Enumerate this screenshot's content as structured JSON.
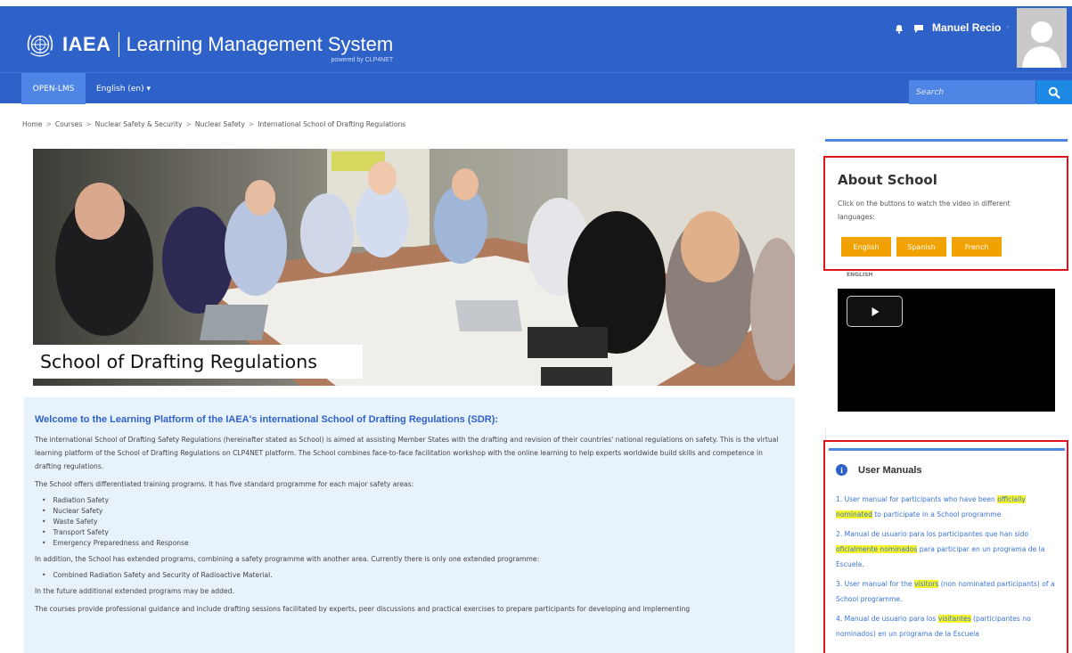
{
  "header": {
    "logo_text": "IAEA",
    "product_title": "Learning Management System",
    "powered_by": "powered by CLP4NET",
    "user_name": "Manuel Recio",
    "user_caret": "-"
  },
  "nav": {
    "home_item": "OPEN-LMS",
    "language": "English (en) ▾",
    "search_placeholder": "Search"
  },
  "breadcrumb": [
    "Home",
    "Courses",
    "Nuclear Safety & Security",
    "Nuclear Safety",
    "International School of Drafting Regulations"
  ],
  "breadcrumb_sep": ">",
  "hero": {
    "caption": "School of Drafting Regulations"
  },
  "main": {
    "heading": "Welcome to the Learning Platform of the IAEA's international School of Drafting Regulations (SDR):",
    "para1": "The international School of Drafting Safety Regulations (hereinafter stated as School) is aimed at assisting Member States with the drafting and revision of their countries' national regulations on safety. This is the virtual learning platform of the School of Drafting Regulations on CLP4NET platform. The School combines face-to-face facilitation workshop with the online learning to help experts worldwide build skills and competence in drafting regulations.",
    "para2": "The School offers differentiated training programs. It has five standard programme for each major safety areas:",
    "areas": [
      "Radiation Safety",
      "Nuclear Safety",
      "Waste Safety",
      "Transport Safety",
      "Emergency Preparedness and Response"
    ],
    "para3": "In addition, the School has extended programs, combining a safety programme with another area. Currently there is only one extended programme:",
    "extended": [
      "Combined Radiation Safety and Security of Radioactive Material."
    ],
    "para4": "In the future additional extended programs may be added.",
    "para5": "The courses provide professional guidance and include drafting sessions facilitated by experts, peer discussions and practical exercises to prepare participants for developing and implementing"
  },
  "about": {
    "title": "About School",
    "text": "Click on the buttons to watch the  video in different languages:",
    "buttons": [
      "English",
      "Spanish",
      "French"
    ],
    "video_label": "ENGLISH"
  },
  "manuals": {
    "title": "User Manuals",
    "items": [
      {
        "pre": "1. User manual for participants who have been ",
        "hl": "officially nominated",
        "post": " to participate in a School programme"
      },
      {
        "pre": "2. Manual de usuario para los participantes que han sido ",
        "hl": "oficialmente nominados",
        "post": " para participar en un programa de la Escuela."
      },
      {
        "pre": "3. User manual for the ",
        "hl": "visitors",
        "post": " (non nominated participants) of a School programme."
      },
      {
        "pre": "4. Manual de usuario para los ",
        "hl": "visitantes",
        "post": " (participantes no nominados) en un programa de la Escuela"
      }
    ]
  },
  "colors": {
    "brand_blue": "#2f62c8",
    "nav_active": "#4f86e6",
    "search_button": "#1e88e5",
    "lang_button": "#f1a100",
    "highlight_border": "#e0121b",
    "highlight_text": "#f5f52a",
    "content_bg": "#e8f2fb"
  },
  "icons": {
    "logo": "un-emblem-icon",
    "bell": "bell-icon",
    "chat": "chat-icon",
    "search": "search-icon",
    "play": "play-icon",
    "info": "info-icon"
  }
}
